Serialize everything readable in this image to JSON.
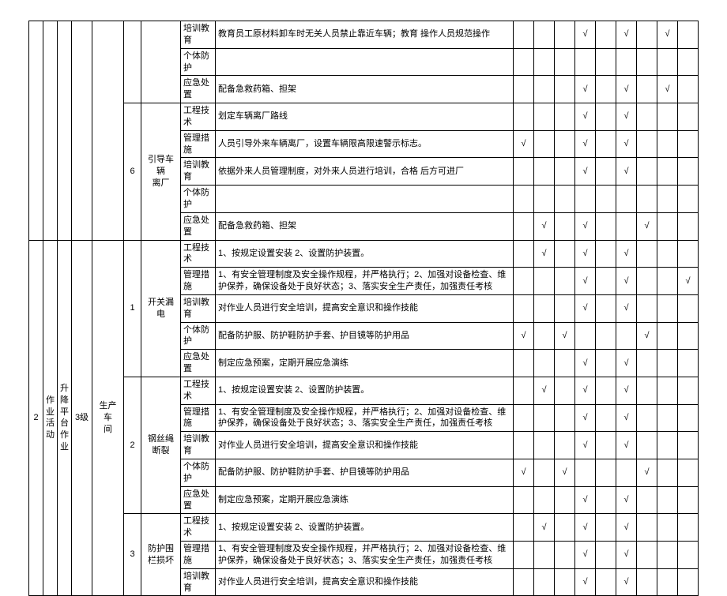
{
  "check": "√",
  "block1": {
    "idx": "6",
    "titleL1": "引导车  辆",
    "titleL2": "离厂",
    "rows": [
      {
        "k": "培训教育",
        "v": "教育员工原材料卸车时无关人员禁止靠近车辆；教育  操作人员规范操作",
        "c": [
          0,
          0,
          0,
          1,
          0,
          1,
          0,
          1,
          0
        ]
      },
      {
        "k": "个体防护",
        "v": "",
        "c": [
          0,
          0,
          0,
          0,
          0,
          0,
          0,
          0,
          0
        ]
      },
      {
        "k": "应急处置",
        "v": "配备急救药箱、担架",
        "c": [
          0,
          0,
          0,
          1,
          0,
          1,
          0,
          1,
          0
        ]
      },
      {
        "k": "工程技术",
        "v": "划定车辆离厂路线",
        "c": [
          0,
          0,
          0,
          1,
          0,
          1,
          0,
          0,
          0
        ]
      },
      {
        "k": "管理措施",
        "v": "人员引导外来车辆离厂，设置车辆限高限速警示标志。",
        "c": [
          1,
          0,
          0,
          1,
          0,
          1,
          0,
          0,
          0
        ]
      },
      {
        "k": "培训教育",
        "v": "依据外来人员管理制度，对外来人员进行培训，合格  后方可进厂",
        "c": [
          0,
          0,
          0,
          1,
          0,
          1,
          0,
          0,
          0
        ]
      },
      {
        "k": "个体防护",
        "v": "",
        "c": [
          0,
          0,
          0,
          0,
          0,
          0,
          0,
          0,
          0
        ]
      },
      {
        "k": "应急处置",
        "v": "配备急救药箱、担架",
        "c": [
          0,
          1,
          0,
          1,
          0,
          0,
          1,
          0,
          0
        ]
      }
    ]
  },
  "block2": {
    "seq": "2",
    "actL1": "作",
    "actL2": "业",
    "actL3": "活",
    "actL4": "动",
    "equipL1": "升",
    "equipL2": "降",
    "equipL3": "平",
    "equipL4": "台",
    "equipL5": "作",
    "equipL6": "业",
    "level": "3级",
    "locL1": "生产  车",
    "locL2": "间",
    "sub": [
      {
        "idx": "1",
        "name": "开关漏  电",
        "rows": [
          {
            "k": "工程技术",
            "v": "1、按规定设置安装 2、设置防护装置。",
            "c": [
              0,
              1,
              0,
              1,
              0,
              1,
              0,
              0,
              0
            ]
          },
          {
            "k": "管理措施",
            "v": "1、有安全管理制度及安全操作规程，并严格执行；2、加强对设备检查、维护保养，确保设备处于良好状态；3、落实安全生产责任，加强责任考核",
            "c": [
              0,
              0,
              0,
              1,
              0,
              1,
              0,
              0,
              1
            ]
          },
          {
            "k": "培训教育",
            "v": "对作业人员进行安全培训，提高安全意识和操作技能",
            "c": [
              0,
              0,
              0,
              1,
              0,
              1,
              0,
              0,
              0
            ]
          },
          {
            "k": "个体防护",
            "v": "配备防护服、防护鞋防护手套、护目镜等防护用品",
            "c": [
              1,
              0,
              1,
              0,
              0,
              0,
              1,
              0,
              0
            ]
          },
          {
            "k": "应急处置",
            "v": "制定应急预案，定期开展应急演练",
            "c": [
              0,
              0,
              0,
              1,
              0,
              1,
              0,
              0,
              0
            ]
          }
        ]
      },
      {
        "idx": "2",
        "name": "钢丝绳  断裂",
        "rows": [
          {
            "k": "工程技术",
            "v": "1、按规定设置安装 2、设置防护装置。",
            "c": [
              0,
              1,
              0,
              1,
              0,
              1,
              0,
              0,
              0
            ]
          },
          {
            "k": "管理措施",
            "v": "1、有安全管理制度及安全操作规程，并严格执行；2、加强对设备检查、维护保养，确保设备处于良好状态；3、落实安全生产责任，加强责任考核",
            "c": [
              0,
              0,
              0,
              1,
              0,
              1,
              0,
              0,
              0
            ]
          },
          {
            "k": "培训教育",
            "v": "对作业人员进行安全培训，提高安全意识和操作技能",
            "c": [
              0,
              0,
              0,
              1,
              0,
              1,
              0,
              0,
              0
            ]
          },
          {
            "k": "个体防护",
            "v": "配备防护服、防护鞋防护手套、护目镜等防护用品",
            "c": [
              1,
              0,
              1,
              0,
              0,
              0,
              1,
              0,
              0
            ]
          },
          {
            "k": "应急处置",
            "v": "制定应急预案，定期开展应急演练",
            "c": [
              0,
              0,
              0,
              1,
              0,
              1,
              0,
              0,
              0
            ]
          }
        ]
      },
      {
        "idx": "3",
        "name": "防护围  栏损坏",
        "rows": [
          {
            "k": "工程技术",
            "v": "1、按规定设置安装 2、设置防护装置。",
            "c": [
              0,
              1,
              0,
              1,
              0,
              1,
              0,
              0,
              0
            ]
          },
          {
            "k": "管理措施",
            "v": "1、有安全管理制度及安全操作规程，并严格执行；2、加强对设备检查、维护保养，确保设备处于良好状态；3、落实安全生产责任，加强责任考核",
            "c": [
              0,
              0,
              0,
              1,
              0,
              1,
              0,
              0,
              0
            ]
          },
          {
            "k": "培训教育",
            "v": "对作业人员进行安全培训，提高安全意识和操作技能",
            "c": [
              0,
              0,
              0,
              1,
              0,
              1,
              0,
              0,
              0
            ]
          }
        ]
      }
    ]
  }
}
